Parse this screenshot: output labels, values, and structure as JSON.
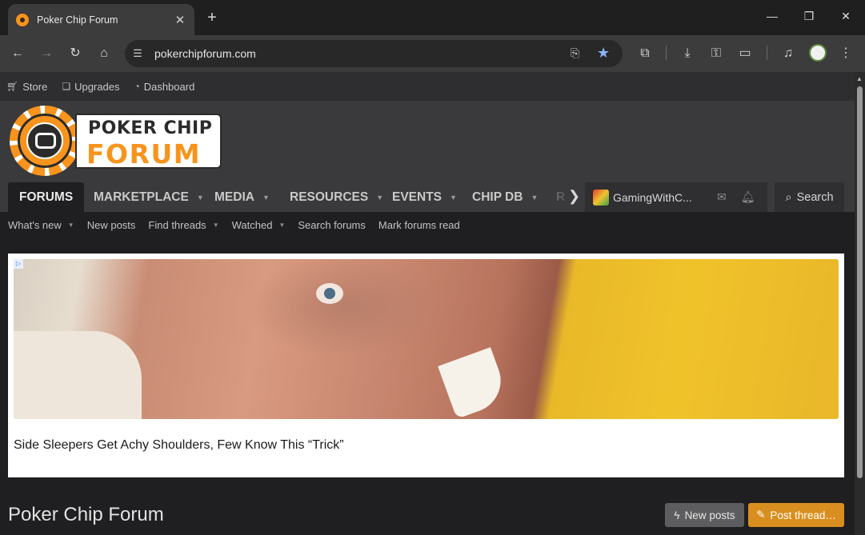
{
  "browser": {
    "tab_title": "Poker Chip Forum",
    "tab_close": "✕",
    "new_tab": "+",
    "url": "pokerchipforum.com",
    "window_controls": {
      "minimize": "—",
      "restore": "❐",
      "close": "✕"
    },
    "icons": [
      "back-icon",
      "forward-icon",
      "reload-icon",
      "home-icon",
      "site-info-icon",
      "install-app-icon",
      "bookmark-star-icon",
      "extensions-icon",
      "downloads-icon",
      "passwords-icon",
      "payment-icon",
      "media-control-icon",
      "profile-avatar",
      "menu-icon"
    ]
  },
  "topbar": {
    "items": [
      {
        "label": "Store",
        "icon": "cart-icon"
      },
      {
        "label": "Upgrades",
        "icon": "upgrades-icon"
      },
      {
        "label": "Dashboard",
        "icon": "dashboard-icon"
      }
    ]
  },
  "logo": {
    "line1": "POKER CHIP",
    "line2": "FORUM",
    "accent": "#f7941d"
  },
  "nav": {
    "tabs": [
      {
        "label": "FORUMS"
      },
      {
        "label": "MARKETPLACE"
      },
      {
        "label": "MEDIA"
      },
      {
        "label": "RESOURCES"
      },
      {
        "label": "EVENTS"
      },
      {
        "label": "CHIP DB"
      },
      {
        "label": "R"
      }
    ],
    "username": "GamingWithC...",
    "search_label": "Search"
  },
  "subnav": {
    "items": [
      {
        "label": "What's new"
      },
      {
        "label": "New posts"
      },
      {
        "label": "Find threads"
      },
      {
        "label": "Watched"
      },
      {
        "label": "Search forums"
      },
      {
        "label": "Mark forums read"
      }
    ]
  },
  "ad": {
    "badge": "▷",
    "caption": "Side Sleepers Get Achy Shoulders, Few Know This “Trick”"
  },
  "page": {
    "title": "Poker Chip Forum",
    "new_posts_label": "New posts",
    "post_thread_label": "Post thread…"
  }
}
